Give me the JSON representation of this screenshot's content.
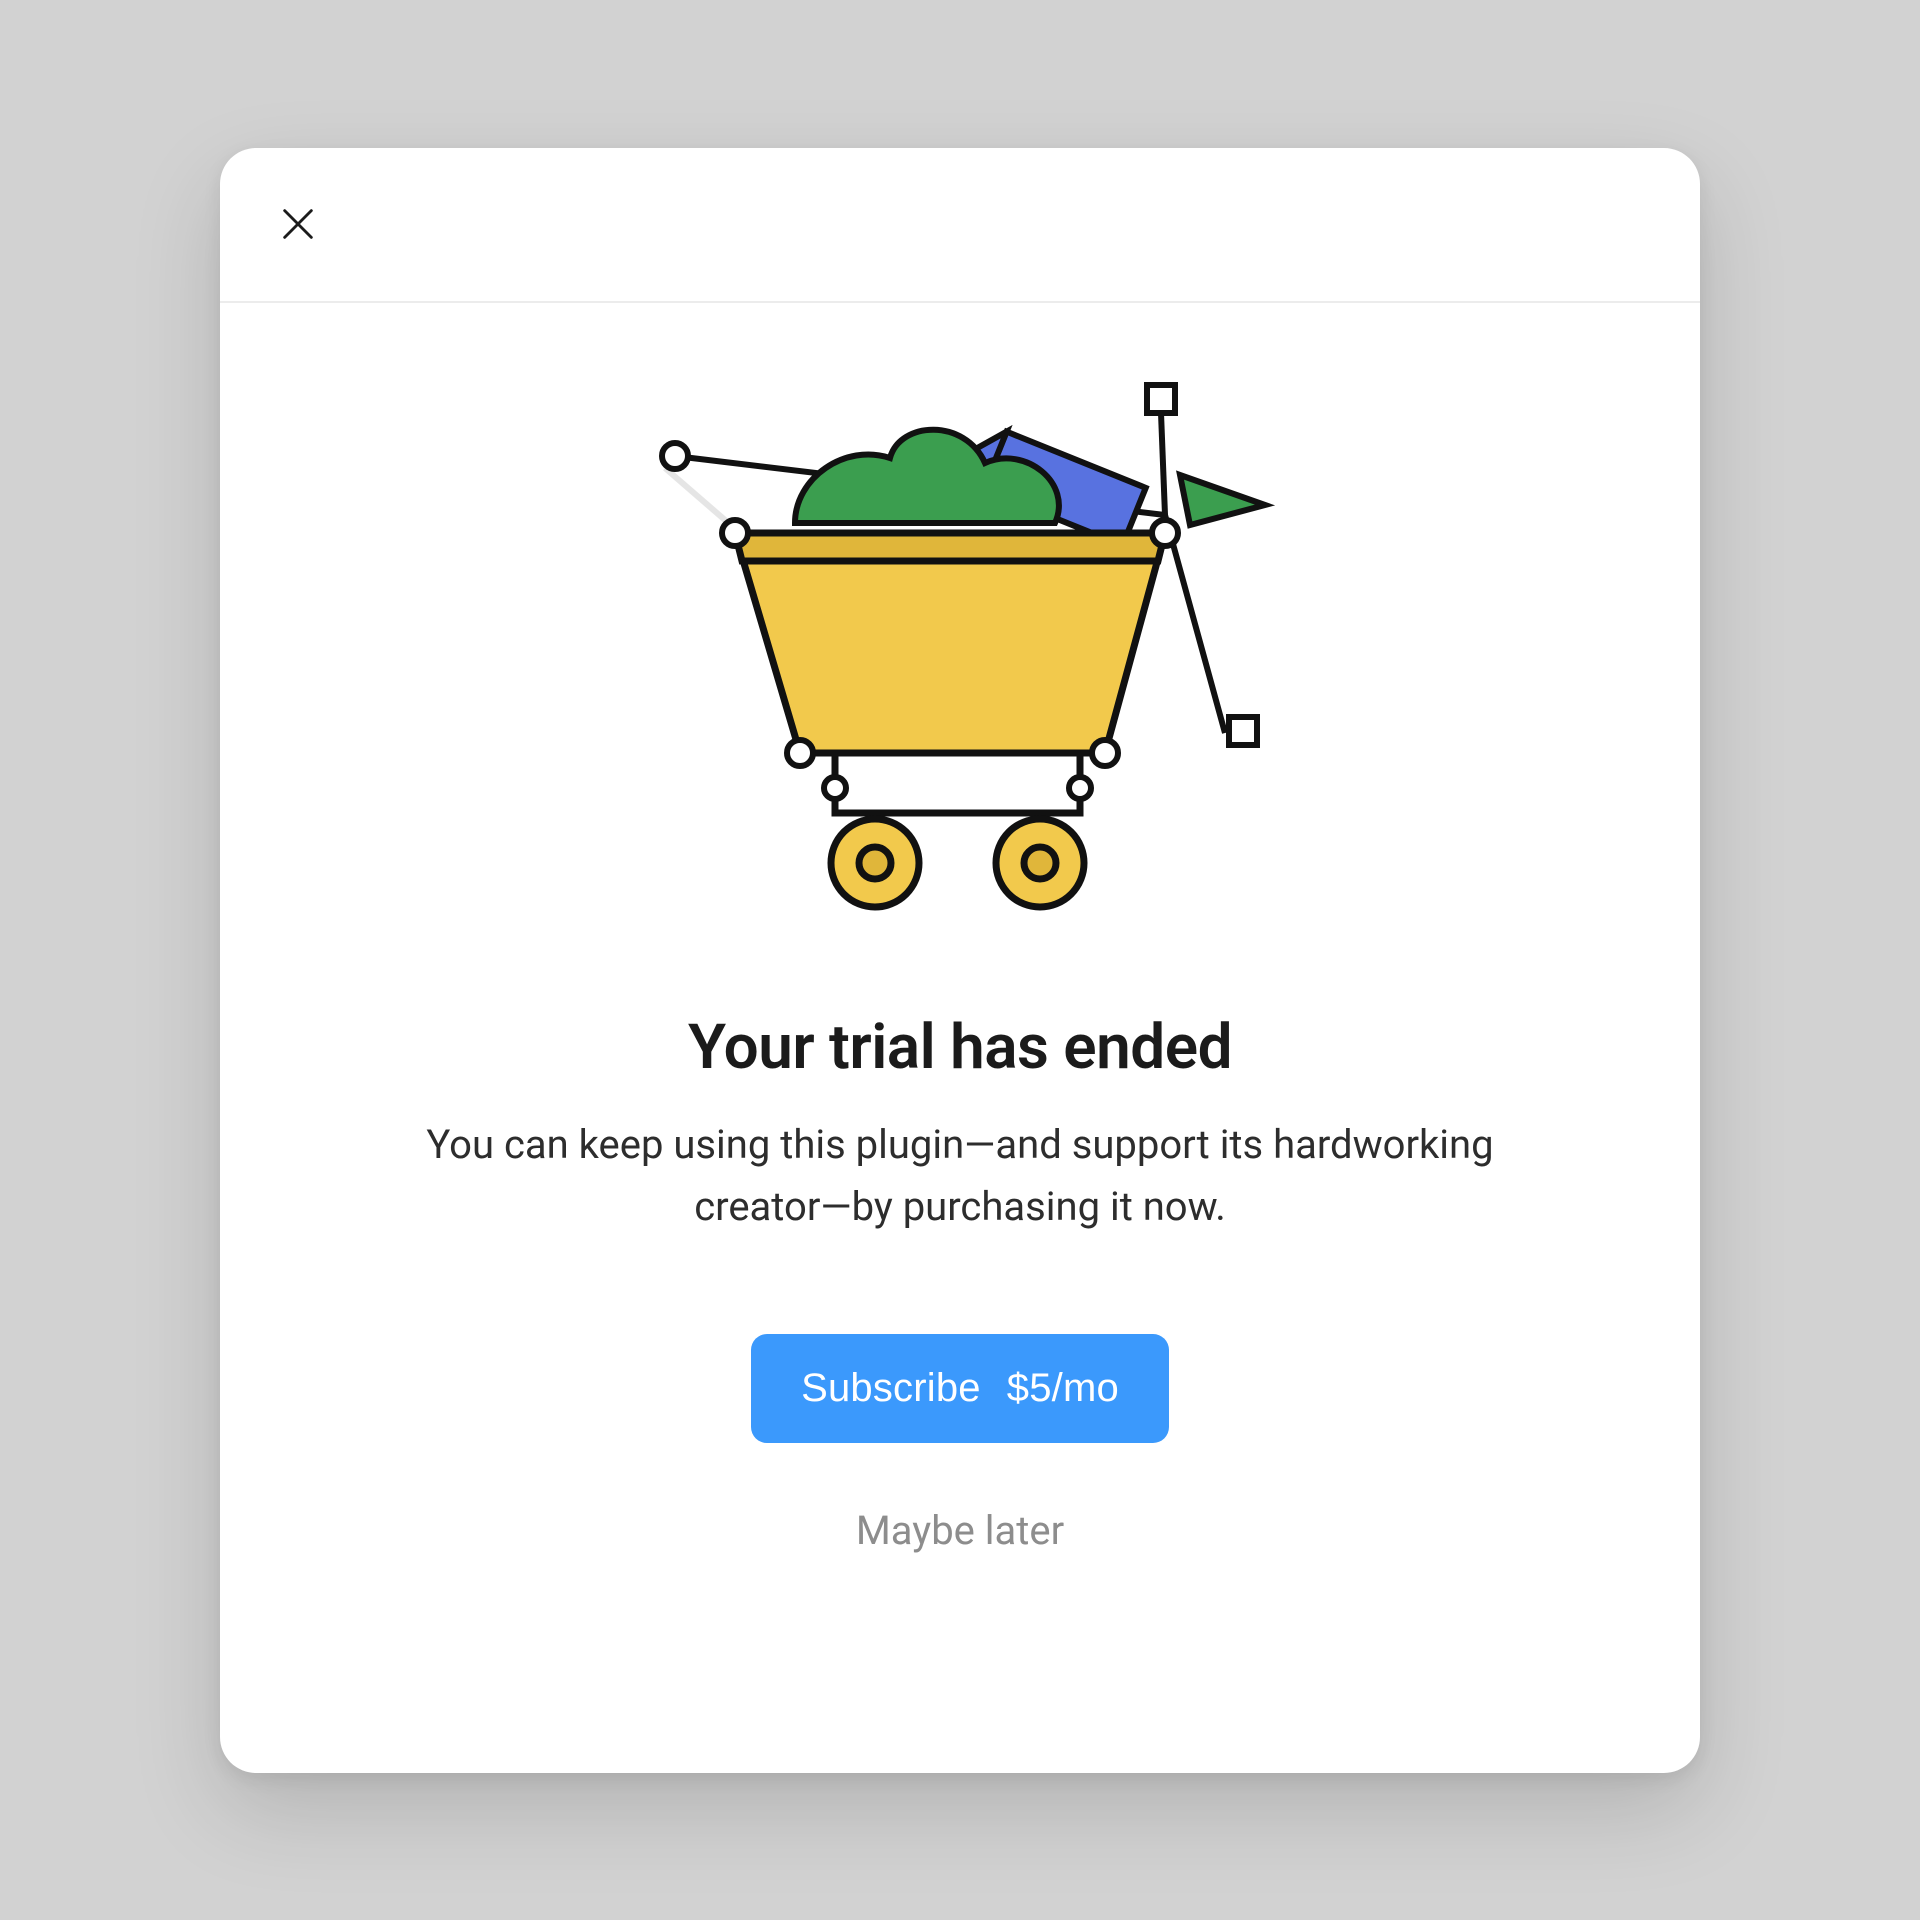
{
  "dialog": {
    "title": "Your trial has ended",
    "subtitle": "You can keep using this plugin—and support its hardworking creator—by purchasing it now."
  },
  "actions": {
    "primary_label": "Subscribe",
    "primary_price": "$5/mo",
    "secondary_label": "Maybe later"
  },
  "illustration": "shopping-cart-design-tools",
  "colors": {
    "accent": "#3b99fc",
    "cart_body": "#f2c94c",
    "cart_dark": "#e0b63a",
    "foliage": "#3b9e4f",
    "pencil": "#5872e0",
    "flag": "#3b9e4f",
    "stroke": "#111111"
  }
}
